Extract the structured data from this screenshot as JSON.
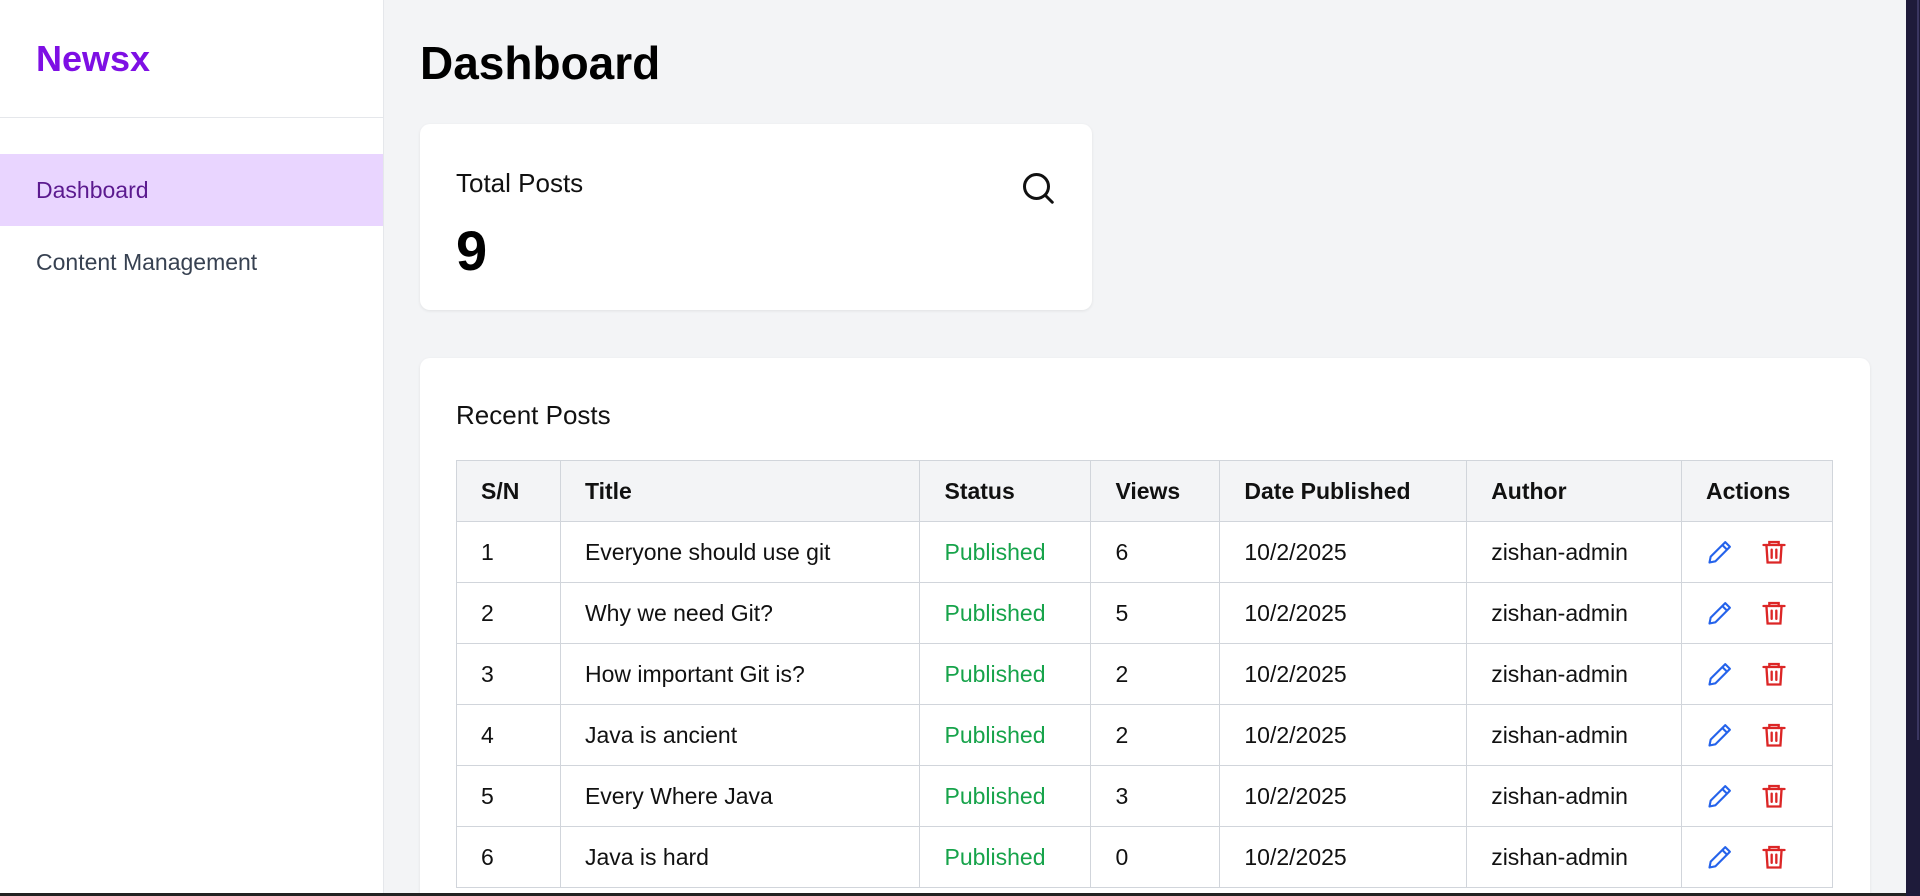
{
  "brand": "Newsx",
  "nav": {
    "items": [
      {
        "label": "Dashboard",
        "active": true
      },
      {
        "label": "Content Management",
        "active": false
      }
    ]
  },
  "page_title": "Dashboard",
  "stats": {
    "label": "Total Posts",
    "value": "9",
    "icon": "search-icon"
  },
  "recent_posts": {
    "title": "Recent Posts",
    "columns": [
      "S/N",
      "Title",
      "Status",
      "Views",
      "Date Published",
      "Author",
      "Actions"
    ],
    "rows": [
      {
        "sn": "1",
        "title": "Everyone should use git",
        "status": "Published",
        "views": "6",
        "date": "10/2/2025",
        "author": "zishan-admin"
      },
      {
        "sn": "2",
        "title": "Why we need Git?",
        "status": "Published",
        "views": "5",
        "date": "10/2/2025",
        "author": "zishan-admin"
      },
      {
        "sn": "3",
        "title": "How important Git is?",
        "status": "Published",
        "views": "2",
        "date": "10/2/2025",
        "author": "zishan-admin"
      },
      {
        "sn": "4",
        "title": "Java is ancient",
        "status": "Published",
        "views": "2",
        "date": "10/2/2025",
        "author": "zishan-admin"
      },
      {
        "sn": "5",
        "title": "Every Where Java",
        "status": "Published",
        "views": "3",
        "date": "10/2/2025",
        "author": "zishan-admin"
      },
      {
        "sn": "6",
        "title": "Java is hard",
        "status": "Published",
        "views": "0",
        "date": "10/2/2025",
        "author": "zishan-admin"
      }
    ],
    "action_icons": [
      "pencil-icon",
      "trash-icon"
    ]
  },
  "colors": {
    "brand": "#7e0fe4",
    "nav_active_bg": "#e9d5ff",
    "status_published": "#16a34a",
    "edit": "#2563eb",
    "delete": "#dc2626"
  }
}
